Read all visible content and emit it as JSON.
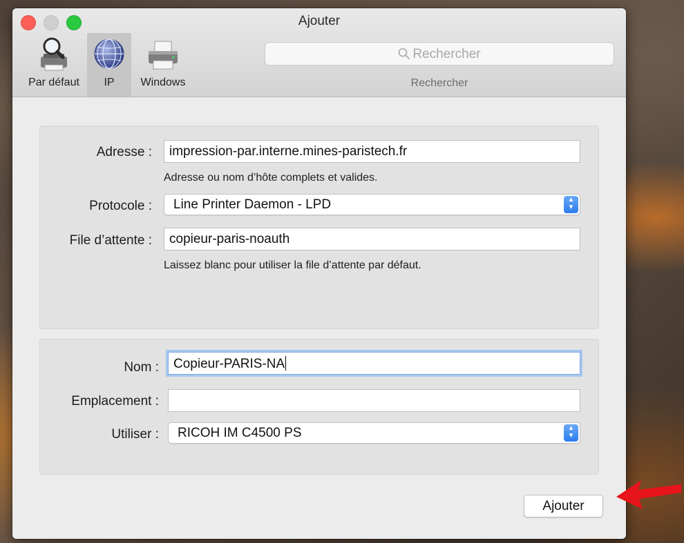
{
  "window": {
    "title": "Ajouter"
  },
  "toolbar": {
    "tabs": [
      {
        "label": "Par défaut",
        "icon": "magnifier-printer-icon",
        "active": false
      },
      {
        "label": "IP",
        "icon": "globe-icon",
        "active": true
      },
      {
        "label": "Windows",
        "icon": "printer-icon",
        "active": false
      }
    ],
    "search": {
      "placeholder": "Rechercher",
      "caption": "Rechercher",
      "icon": "search-icon"
    }
  },
  "address_section": {
    "address_label": "Adresse :",
    "address_value": "impression-par.interne.mines-paristech.fr",
    "address_help": "Adresse ou nom d’hôte complets et valides.",
    "protocol_label": "Protocole :",
    "protocol_value": "Line Printer Daemon - LPD",
    "queue_label": "File d’attente :",
    "queue_value": "copieur-paris-noauth",
    "queue_help": "Laissez blanc pour utiliser la file d’attente par défaut."
  },
  "printer_section": {
    "name_label": "Nom :",
    "name_value": "Copieur-PARIS-NA",
    "location_label": "Emplacement :",
    "location_value": "",
    "use_label": "Utiliser :",
    "use_value": "RICOH IM C4500 PS"
  },
  "actions": {
    "add_label": "Ajouter"
  },
  "colors": {
    "accent": "#2c7cf0",
    "annotation_arrow": "#e8141b"
  }
}
